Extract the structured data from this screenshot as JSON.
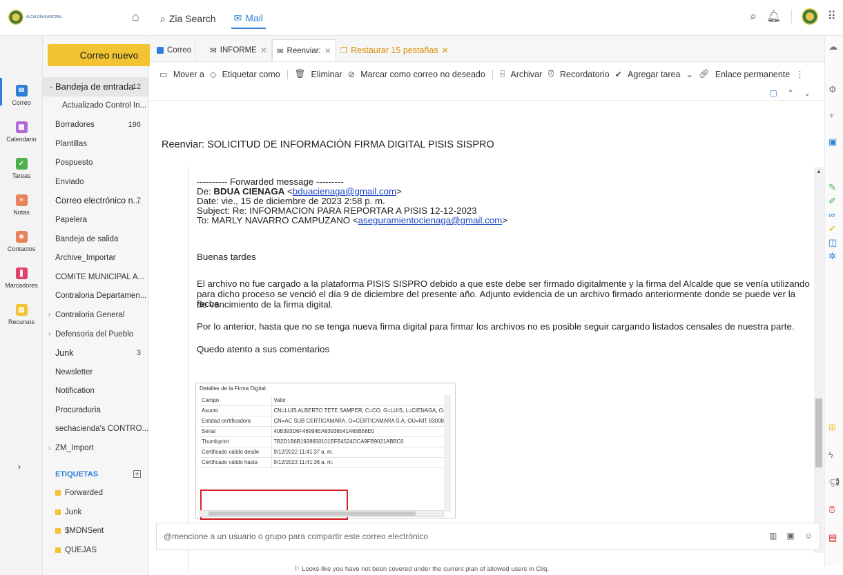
{
  "topbar": {
    "org_name": "ALCALDÍA MUNICIPAL",
    "zia_search": "Zia Search",
    "mail": "Mail"
  },
  "rail": [
    {
      "label": "Correo",
      "color": "#2b7fd8"
    },
    {
      "label": "Calendario",
      "color": "#b468d6"
    },
    {
      "label": "Tareas",
      "color": "#4caf50"
    },
    {
      "label": "Notas",
      "color": "#e8825a"
    },
    {
      "label": "Contactos",
      "color": "#e8825a"
    },
    {
      "label": "Marcadores",
      "color": "#e0406a"
    },
    {
      "label": "Recursos",
      "color": "#f2c332"
    }
  ],
  "new_mail": "Correo nuevo",
  "folders": [
    {
      "label": "Bandeja de entrada",
      "count": "12"
    },
    {
      "label": "Actualizado Control In...",
      "count": ""
    },
    {
      "label": "Borradores",
      "count": "196"
    },
    {
      "label": "Plantillas",
      "count": ""
    },
    {
      "label": "Pospuesto",
      "count": ""
    },
    {
      "label": "Enviado",
      "count": ""
    },
    {
      "label": "Correo electrónico n...",
      "count": "7"
    },
    {
      "label": "Papelera",
      "count": ""
    },
    {
      "label": "Bandeja de salida",
      "count": ""
    },
    {
      "label": "Archive_Importar",
      "count": ""
    },
    {
      "label": "COMITE MUNICIPAL A...",
      "count": ""
    },
    {
      "label": "Contraloria Departamen...",
      "count": ""
    },
    {
      "label": "Contraloria General",
      "count": ""
    },
    {
      "label": "Defensoria del Pueblo",
      "count": ""
    },
    {
      "label": "Junk",
      "count": "3"
    },
    {
      "label": "Newsletter",
      "count": ""
    },
    {
      "label": "Notification",
      "count": ""
    },
    {
      "label": "Procuraduria",
      "count": ""
    },
    {
      "label": "sechacienda's CONTRO...",
      "count": ""
    },
    {
      "label": "ZM_Import",
      "count": ""
    }
  ],
  "labels_head": "ETIQUETAS",
  "labels": [
    "Forwarded",
    "Junk",
    "$MDNSent",
    "QUEJAS"
  ],
  "tabs": {
    "t1": "Correo",
    "t2": "INFORME",
    "t3": "Reenviar:",
    "restore": "Restaurar 15 pestañas"
  },
  "toolbar": {
    "move": "Mover a",
    "tag": "Etiquetar como",
    "delete": "Eliminar",
    "spam": "Marcar como correo no deseado",
    "archive": "Archivar",
    "reminder": "Recordatorio",
    "task": "Agregar tarea",
    "link": "Enlace permanente"
  },
  "subject": "Reenviar: SOLICITUD DE INFORMACIÓN FIRMA DIGITAL PISIS SISPRO",
  "message": {
    "fwd": "---------- Forwarded message ---------",
    "from_label": "De: ",
    "from_name": "BDUA CIENAGA",
    "from_email": "bduacienaga@gmail.com",
    "date": "Date: vie., 15 de diciembre de 2023 2:58 p. m.",
    "subj": "Subject: Re: INFORMACION PARA REPORTAR A PISIS 12-12-2023",
    "to_label": "To: MARLY NAVARRO CAMPUZANO <",
    "to_email": "aseguramientocienaga@gmail.com",
    "greeting": "Buenas tardes",
    "p1a": "El archivo no fue cargado a la plataforma PISIS SISPRO debido a que este debe ser firmado digitalmente y la firma del Alcalde que se venía utilizando",
    "p1b": "para dicho proceso se venció el día 9 de diciembre del presente año. Adjunto evidencia de un archivo firmado anteriormente donde se puede ver la fecha",
    "p1c": "de vencimiento de la firma digital.",
    "p2": "Por lo anterior, hasta que no se tenga nueva firma digital para firmar los archivos no es posible seguir cargando listados censales de nuestra parte.",
    "p3": "Quedo atento a sus comentarios"
  },
  "signature": {
    "title": "Detalles de la Firma Digital:",
    "rows": [
      [
        "Campo",
        "Valor"
      ],
      [
        "Asunto",
        "CN=LUIS ALBERTO TETE SAMPER, C=CO, G=LUIS, L=CIENAGA, O=M"
      ],
      [
        "Entidad certificadora",
        "CN=AC SUB CERTICAMARA, O=CERTICAMARA S.A, OU=NIT 83008"
      ],
      [
        "Serial",
        "40B393D6F46994EA63936541A65B56E0"
      ],
      [
        "Thumbprint",
        "7B2D1B6B1928650101EFB4524DCA9FB9021ABBC0"
      ],
      [
        "Certificado válido desde",
        "9/12/2022 11:41:37 a. m."
      ],
      [
        "Certificado válido hasta",
        "9/12/2023 11:41:36 a. m."
      ]
    ]
  },
  "compose_placeholder": "@mencione a un usuario o grupo para compartir este correo electrónico",
  "footer": "Looks like you have not been covered under the current plan of allowed users in Cliq."
}
